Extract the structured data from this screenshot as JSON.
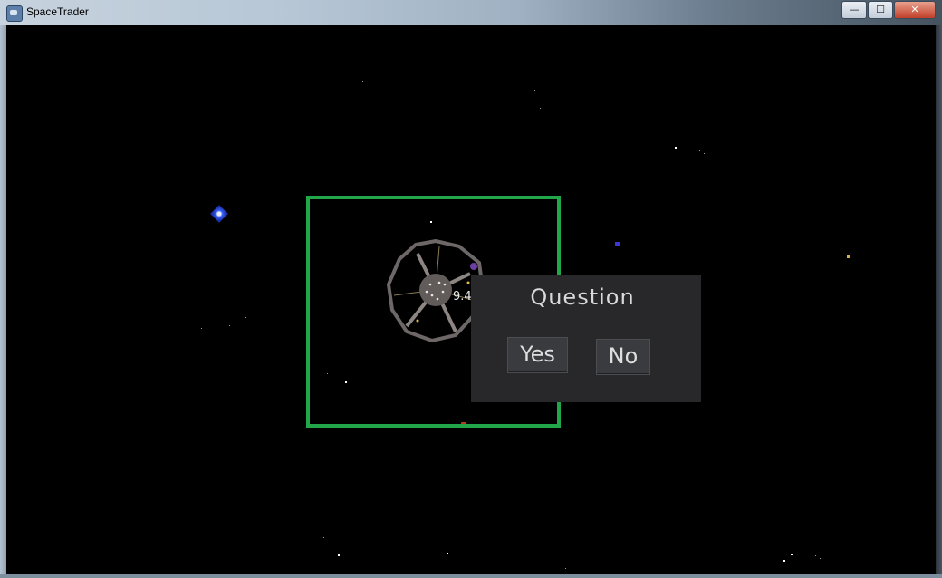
{
  "window": {
    "title": "SpaceTrader",
    "controls": {
      "minimize": "—",
      "maximize": "☐",
      "close": "✕"
    }
  },
  "map": {
    "distance_label": "9.4",
    "station_icon": "space-station-icon",
    "colors": {
      "selection": "#21a64a",
      "background": "#000000"
    }
  },
  "dialog": {
    "title": "Question",
    "yes_label": "Yes",
    "no_label": "No"
  }
}
